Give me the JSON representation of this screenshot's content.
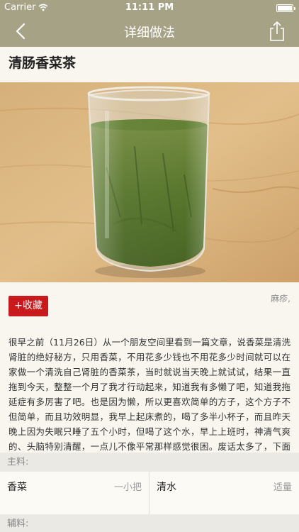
{
  "status_bar": {
    "carrier": "Carrier",
    "time": "11:11 PM"
  },
  "nav": {
    "title": "详细做法"
  },
  "recipe": {
    "title": "清肠香菜茶",
    "favorite_label": "+收藏",
    "author": "麻疹,",
    "description": "很早之前（11月26日）从一个朋友空间里看到一篇文章，说香菜是清洗肾脏的绝好秘方，只用香菜，不用花多少钱也不用花多少时间就可以在家做一个清洗自己肾脏的香菜茶，当时就说当天晚上就试试，结果一直拖到今天，整整一个月了我才行动起来，知道我有多懒了吧，知道我拖延症有多厉害了吧。也是因为懒，所以更喜欢简单的方子，这个方子不但简单，而且功效明显，我早上起床煮的，喝了多半小杯子，而且昨天晚上因为失眠只睡了五个小时，但喝了这个水，早上上班时，神清气爽的、头脑特别清醒，一点儿不像平常那样感觉很困。废话太多了，下面就来见证一"
  },
  "main_ingredients": {
    "header": "主料:",
    "items": [
      {
        "name": "香菜",
        "amount": "一小把"
      },
      {
        "name": "清水",
        "amount": "适量"
      }
    ]
  },
  "secondary_ingredients": {
    "header": "辅料:"
  },
  "colors": {
    "nav_bg": "#a5a286",
    "accent_red": "#c8191c",
    "page_bg": "#f8f6ef"
  }
}
